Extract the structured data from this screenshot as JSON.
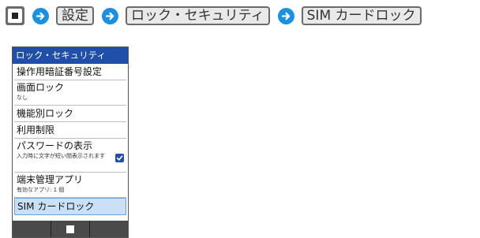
{
  "breadcrumb": {
    "steps": [
      "設定",
      "ロック・セキュリティ",
      "SIM カードロック"
    ]
  },
  "screen": {
    "title": "ロック・セキュリティ",
    "items": [
      {
        "label": "操作用暗証番号設定"
      },
      {
        "label": "画面ロック",
        "sub": "なし"
      },
      {
        "label": "機能別ロック"
      },
      {
        "label": "利用制限"
      },
      {
        "label": "パスワードの表示",
        "sub": "入力時に文字が短い間表示されます",
        "checked": true
      },
      {
        "label": "端末管理アプリ",
        "sub": "有効なアプリ: 1 個"
      },
      {
        "label": "SIM カードロック",
        "selected": true
      }
    ]
  },
  "colors": {
    "arrow": "#1d8fe0",
    "title_bar": "#1f4fa8",
    "selected_row": "#c9e0f7"
  }
}
